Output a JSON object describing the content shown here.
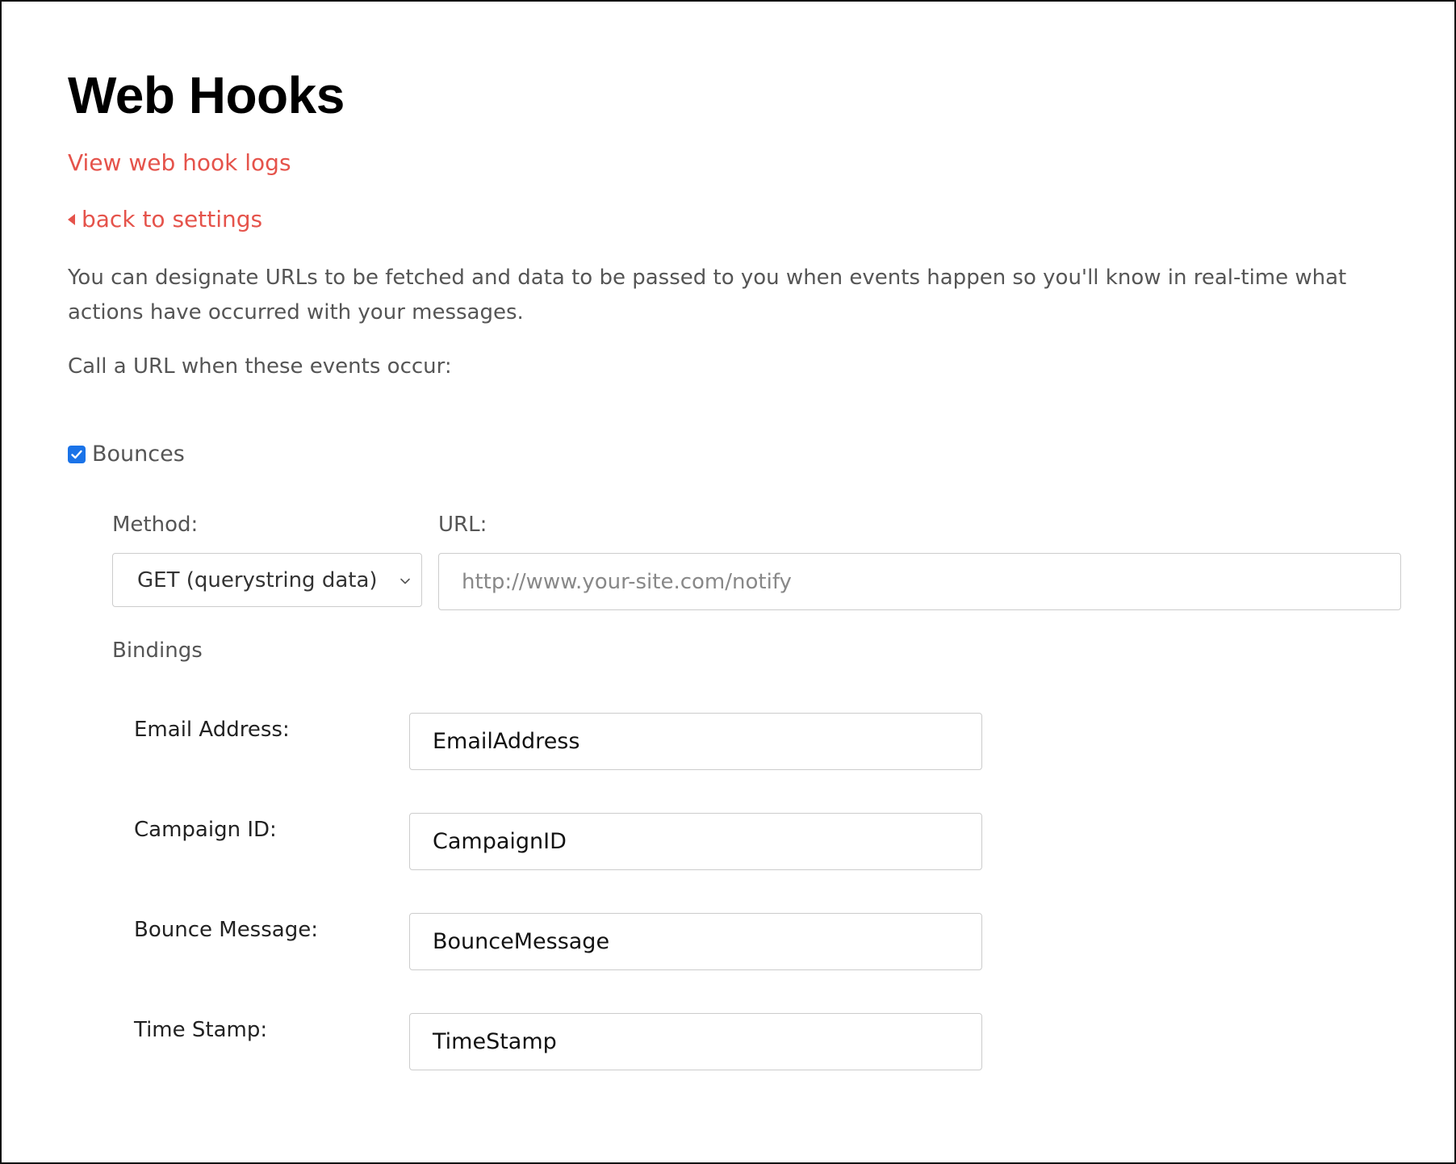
{
  "header": {
    "title": "Web Hooks"
  },
  "links": {
    "view_logs": "View web hook logs",
    "back_to_settings": "back to settings"
  },
  "intro": {
    "description": "You can designate URLs to be fetched and data to be passed to you when events happen so you'll know in real-time what actions have occurred with your messages.",
    "call_prompt": "Call a URL when these events occur:"
  },
  "events": {
    "bounces": {
      "label": "Bounces",
      "checked": true,
      "method_label": "Method:",
      "method_value": "GET (querystring data)",
      "url_label": "URL:",
      "url_placeholder": "http://www.your-site.com/notify",
      "bindings_label": "Bindings",
      "bindings": [
        {
          "label": "Email Address:",
          "value": "EmailAddress"
        },
        {
          "label": "Campaign ID:",
          "value": "CampaignID"
        },
        {
          "label": "Bounce Message:",
          "value": "BounceMessage"
        },
        {
          "label": "Time Stamp:",
          "value": "TimeStamp"
        }
      ]
    }
  },
  "colors": {
    "link": "#e5534b",
    "checkbox": "#1a73e8",
    "title": "#000000",
    "body_text": "#555555"
  }
}
